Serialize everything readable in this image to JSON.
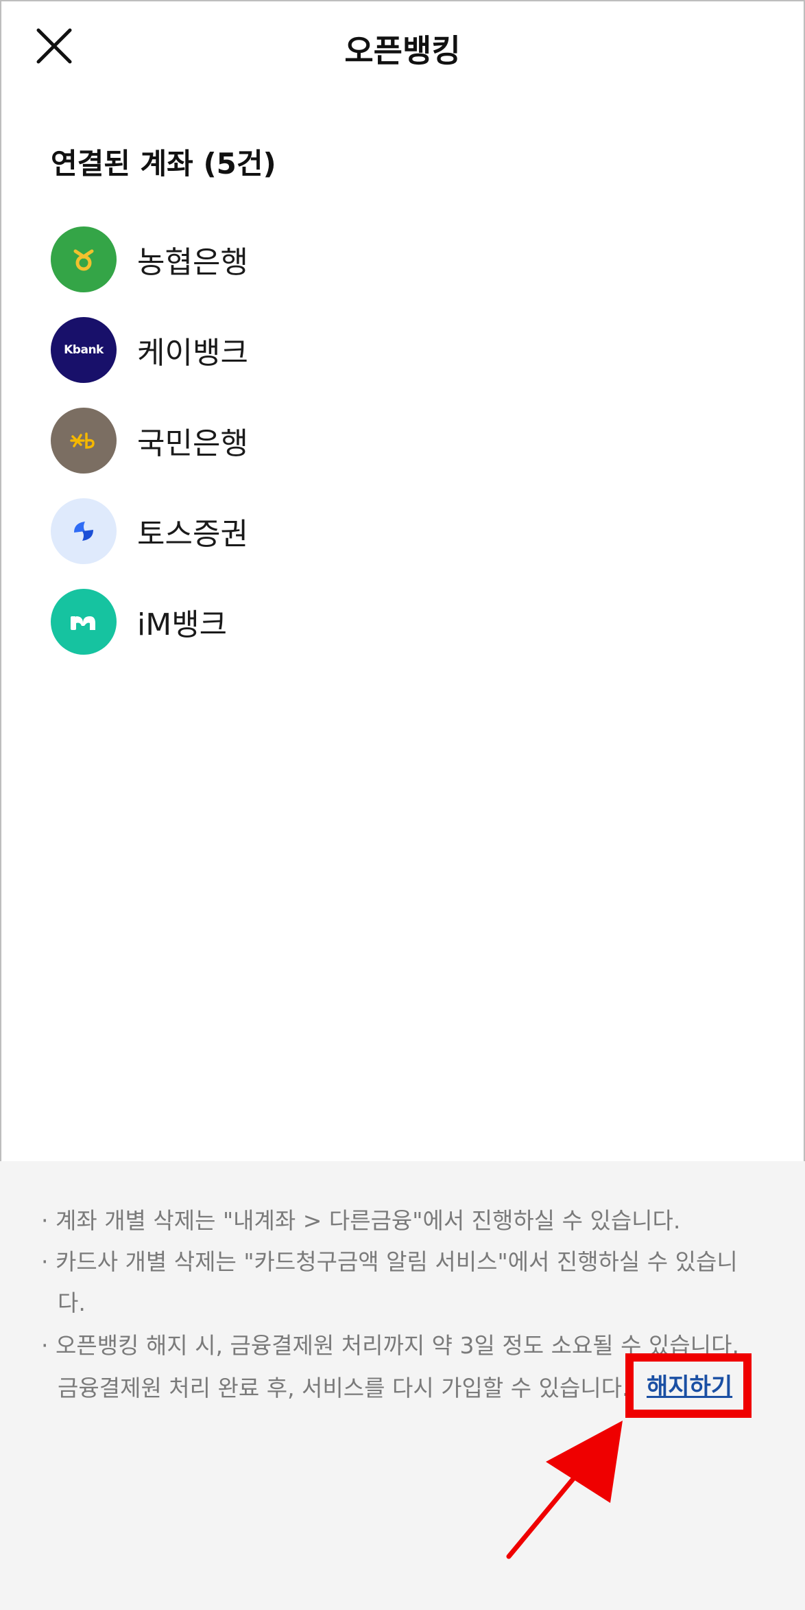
{
  "header": {
    "title": "오픈뱅킹",
    "close_icon": "close-icon"
  },
  "accounts": {
    "section_title": "연결된 계좌 (5건)",
    "items": [
      {
        "name": "농협은행",
        "logo": "nh-bank-logo",
        "color": "#34a547"
      },
      {
        "name": "케이뱅크",
        "logo": "kbank-logo",
        "logo_text": "Kbank",
        "color": "#18106a"
      },
      {
        "name": "국민은행",
        "logo": "kb-bank-logo",
        "color": "#7b6e62"
      },
      {
        "name": "토스증권",
        "logo": "toss-securities-logo",
        "color": "#dfeafc"
      },
      {
        "name": "iM뱅크",
        "logo": "im-bank-logo",
        "color": "#16c3a0"
      }
    ]
  },
  "notice": {
    "line1": "· 계좌 개별 삭제는 \"내계좌 > 다른금융\"에서 진행하실 수 있습니다.",
    "line2a": "· 카드사 개별 삭제는 \"카드청구금액 알림 서비스\"에서 진행하실 수 있습니",
    "line2b": "다.",
    "line3a": "· 오픈뱅킹 해지 시, 금융결제원 처리까지 약 3일 정도 소요될 수 있습니다.",
    "line3b": "금융결제원 처리 완료 후, 서비스를 다시 가입할 수 있습니다.",
    "terminate_label": "해지하기"
  },
  "annotation": {
    "highlight_color": "#ef0000",
    "arrow_icon": "red-arrow-icon"
  }
}
